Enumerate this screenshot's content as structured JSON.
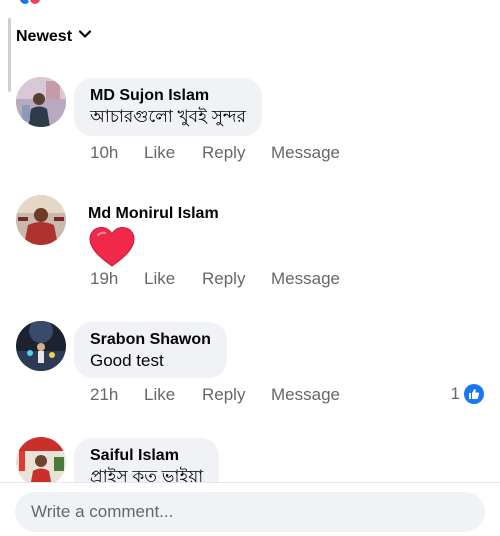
{
  "sort": {
    "label": "Newest"
  },
  "comments": [
    {
      "author": "MD Sujon Islam",
      "text": "আচারগুলো খুবই সুন্দর",
      "time": "10h",
      "like": "Like",
      "reply": "Reply",
      "message": "Message"
    },
    {
      "author": "Md Monirul Islam",
      "text": "❤️",
      "time": "19h",
      "like": "Like",
      "reply": "Reply",
      "message": "Message"
    },
    {
      "author": "Srabon Shawon",
      "text": "Good test",
      "time": "21h",
      "like": "Like",
      "reply": "Reply",
      "message": "Message",
      "reaction_count": "1"
    },
    {
      "author": "Saiful Islam",
      "text": "প্রাইস কত ভাইয়া"
    }
  ],
  "composer": {
    "placeholder": "Write a comment..."
  },
  "colors": {
    "accent": "#1877f2",
    "bubble": "#f0f2f5",
    "muted": "#65676b",
    "heart": "#f02849"
  }
}
